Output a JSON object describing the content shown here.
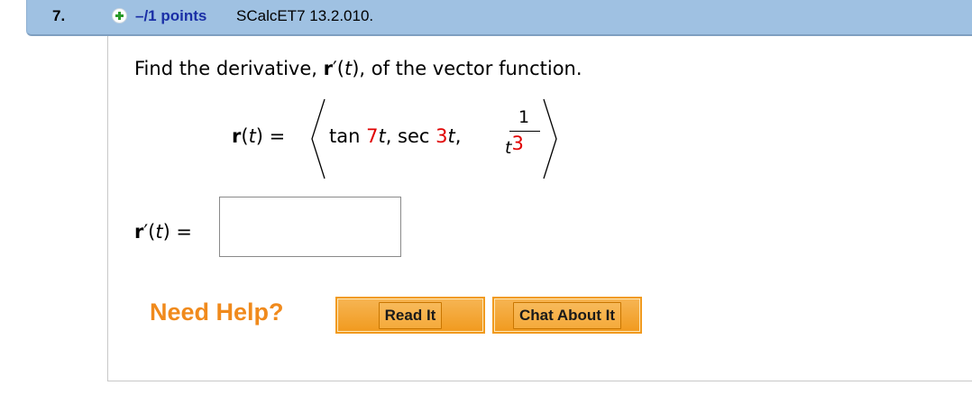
{
  "header": {
    "question_number": "7.",
    "points": "–/1 points",
    "source": "SCalcET7 13.2.010."
  },
  "question": {
    "prefix": "Find the derivative, ",
    "r_bold": "r",
    "prime_open": "′(",
    "t": "t",
    "suffix": "), of the vector function."
  },
  "equation": {
    "r_bold": "r",
    "open": "(",
    "t": "t",
    "close_eq": ")  =",
    "tan": "tan ",
    "tan_coef": "7",
    "t1": "t",
    "sep1": ", sec ",
    "sec_coef": "3",
    "t2": "t",
    "sep2": ",",
    "frac_num": "1",
    "frac_den_t": "t",
    "frac_den_exp": "3"
  },
  "answer": {
    "r_bold": "r",
    "prime_open": "′(",
    "t": "t",
    "close_eq": ")  =",
    "value": ""
  },
  "help": {
    "label": "Need Help?",
    "read_button": "Read It",
    "chat_button": "Chat About It"
  },
  "colors": {
    "header_bg": "#9fc1e2",
    "points_blue": "#1a2fa6",
    "highlight_red": "#e00000",
    "help_orange": "#f08a1c"
  },
  "icons": {
    "expand": "plus-icon"
  }
}
